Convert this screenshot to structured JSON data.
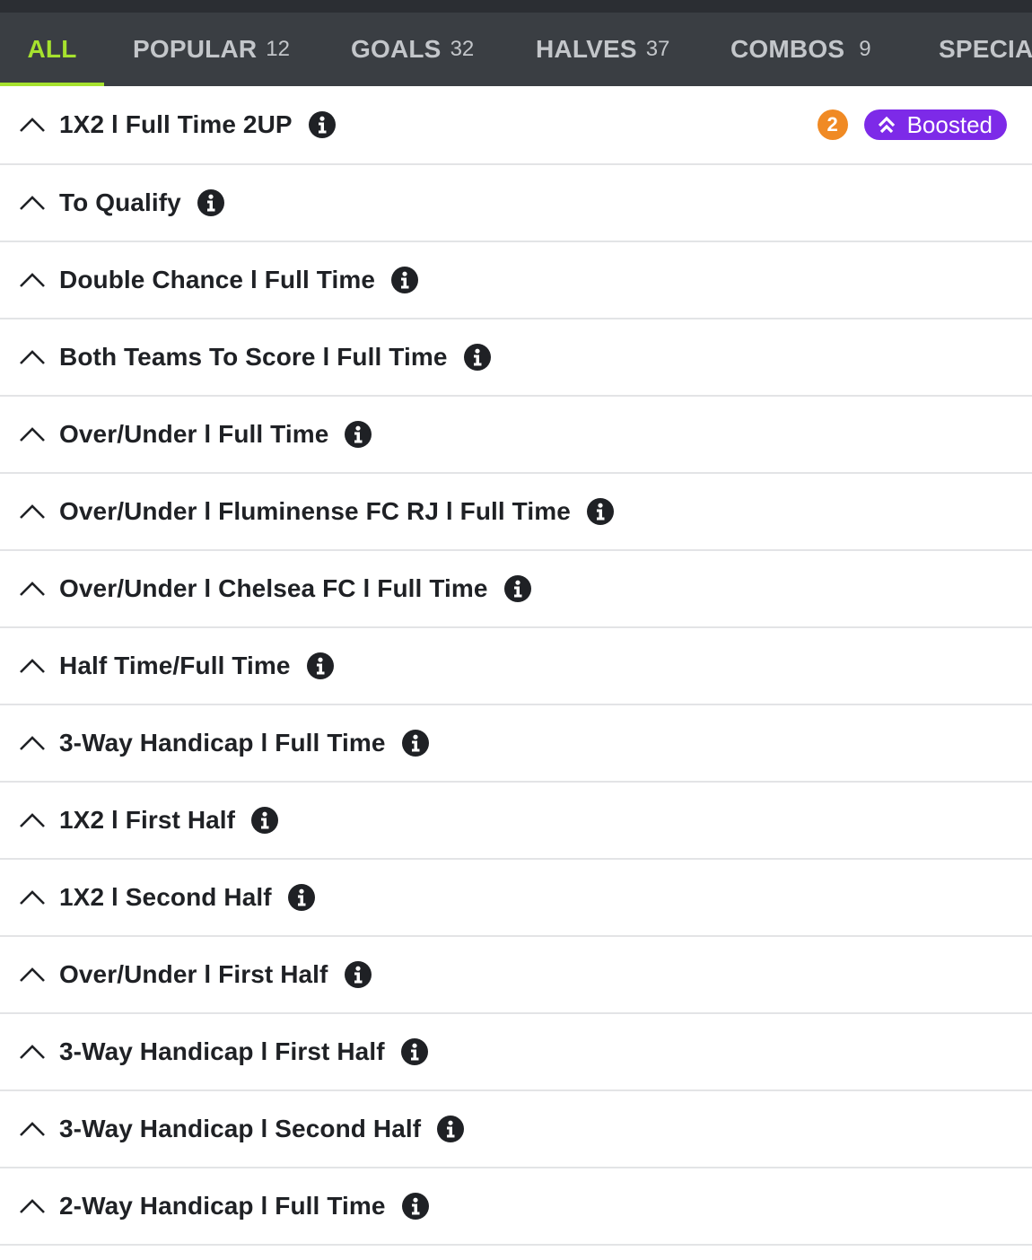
{
  "tabs": [
    {
      "label": "ALL",
      "count": "",
      "active": true
    },
    {
      "label": "POPULAR",
      "count": "12",
      "active": false
    },
    {
      "label": "GOALS",
      "count": "32",
      "active": false
    },
    {
      "label": "HALVES",
      "count": "37",
      "active": false
    },
    {
      "label": "COMBOS",
      "count": "9",
      "active": false
    },
    {
      "label": "SPECIA",
      "count": "",
      "active": false
    }
  ],
  "badges": {
    "twoup_label": "2",
    "boosted_label": "Boosted"
  },
  "markets": [
    {
      "title": "1X2 l Full Time 2UP"
    },
    {
      "title": "To Qualify"
    },
    {
      "title": "Double Chance l Full Time"
    },
    {
      "title": "Both Teams To Score l Full Time"
    },
    {
      "title": "Over/Under l Full Time"
    },
    {
      "title": "Over/Under l Fluminense FC RJ l Full Time"
    },
    {
      "title": "Over/Under l Chelsea FC l Full Time"
    },
    {
      "title": "Half Time/Full Time"
    },
    {
      "title": "3-Way Handicap l Full Time"
    },
    {
      "title": "1X2 l First Half"
    },
    {
      "title": "1X2 l Second Half"
    },
    {
      "title": "Over/Under l First Half"
    },
    {
      "title": "3-Way Handicap l First Half"
    },
    {
      "title": "3-Way Handicap l Second Half"
    },
    {
      "title": "2-Way Handicap l Full Time"
    }
  ],
  "colors": {
    "tab_bar": "#3a3e43",
    "active_tab": "#a6e22e",
    "twoup": "#f08a24",
    "boosted": "#7d2ae8"
  },
  "icons": {
    "chevron": "chevron-up-icon",
    "info": "info-icon",
    "boost": "double-chevron-up-icon"
  }
}
